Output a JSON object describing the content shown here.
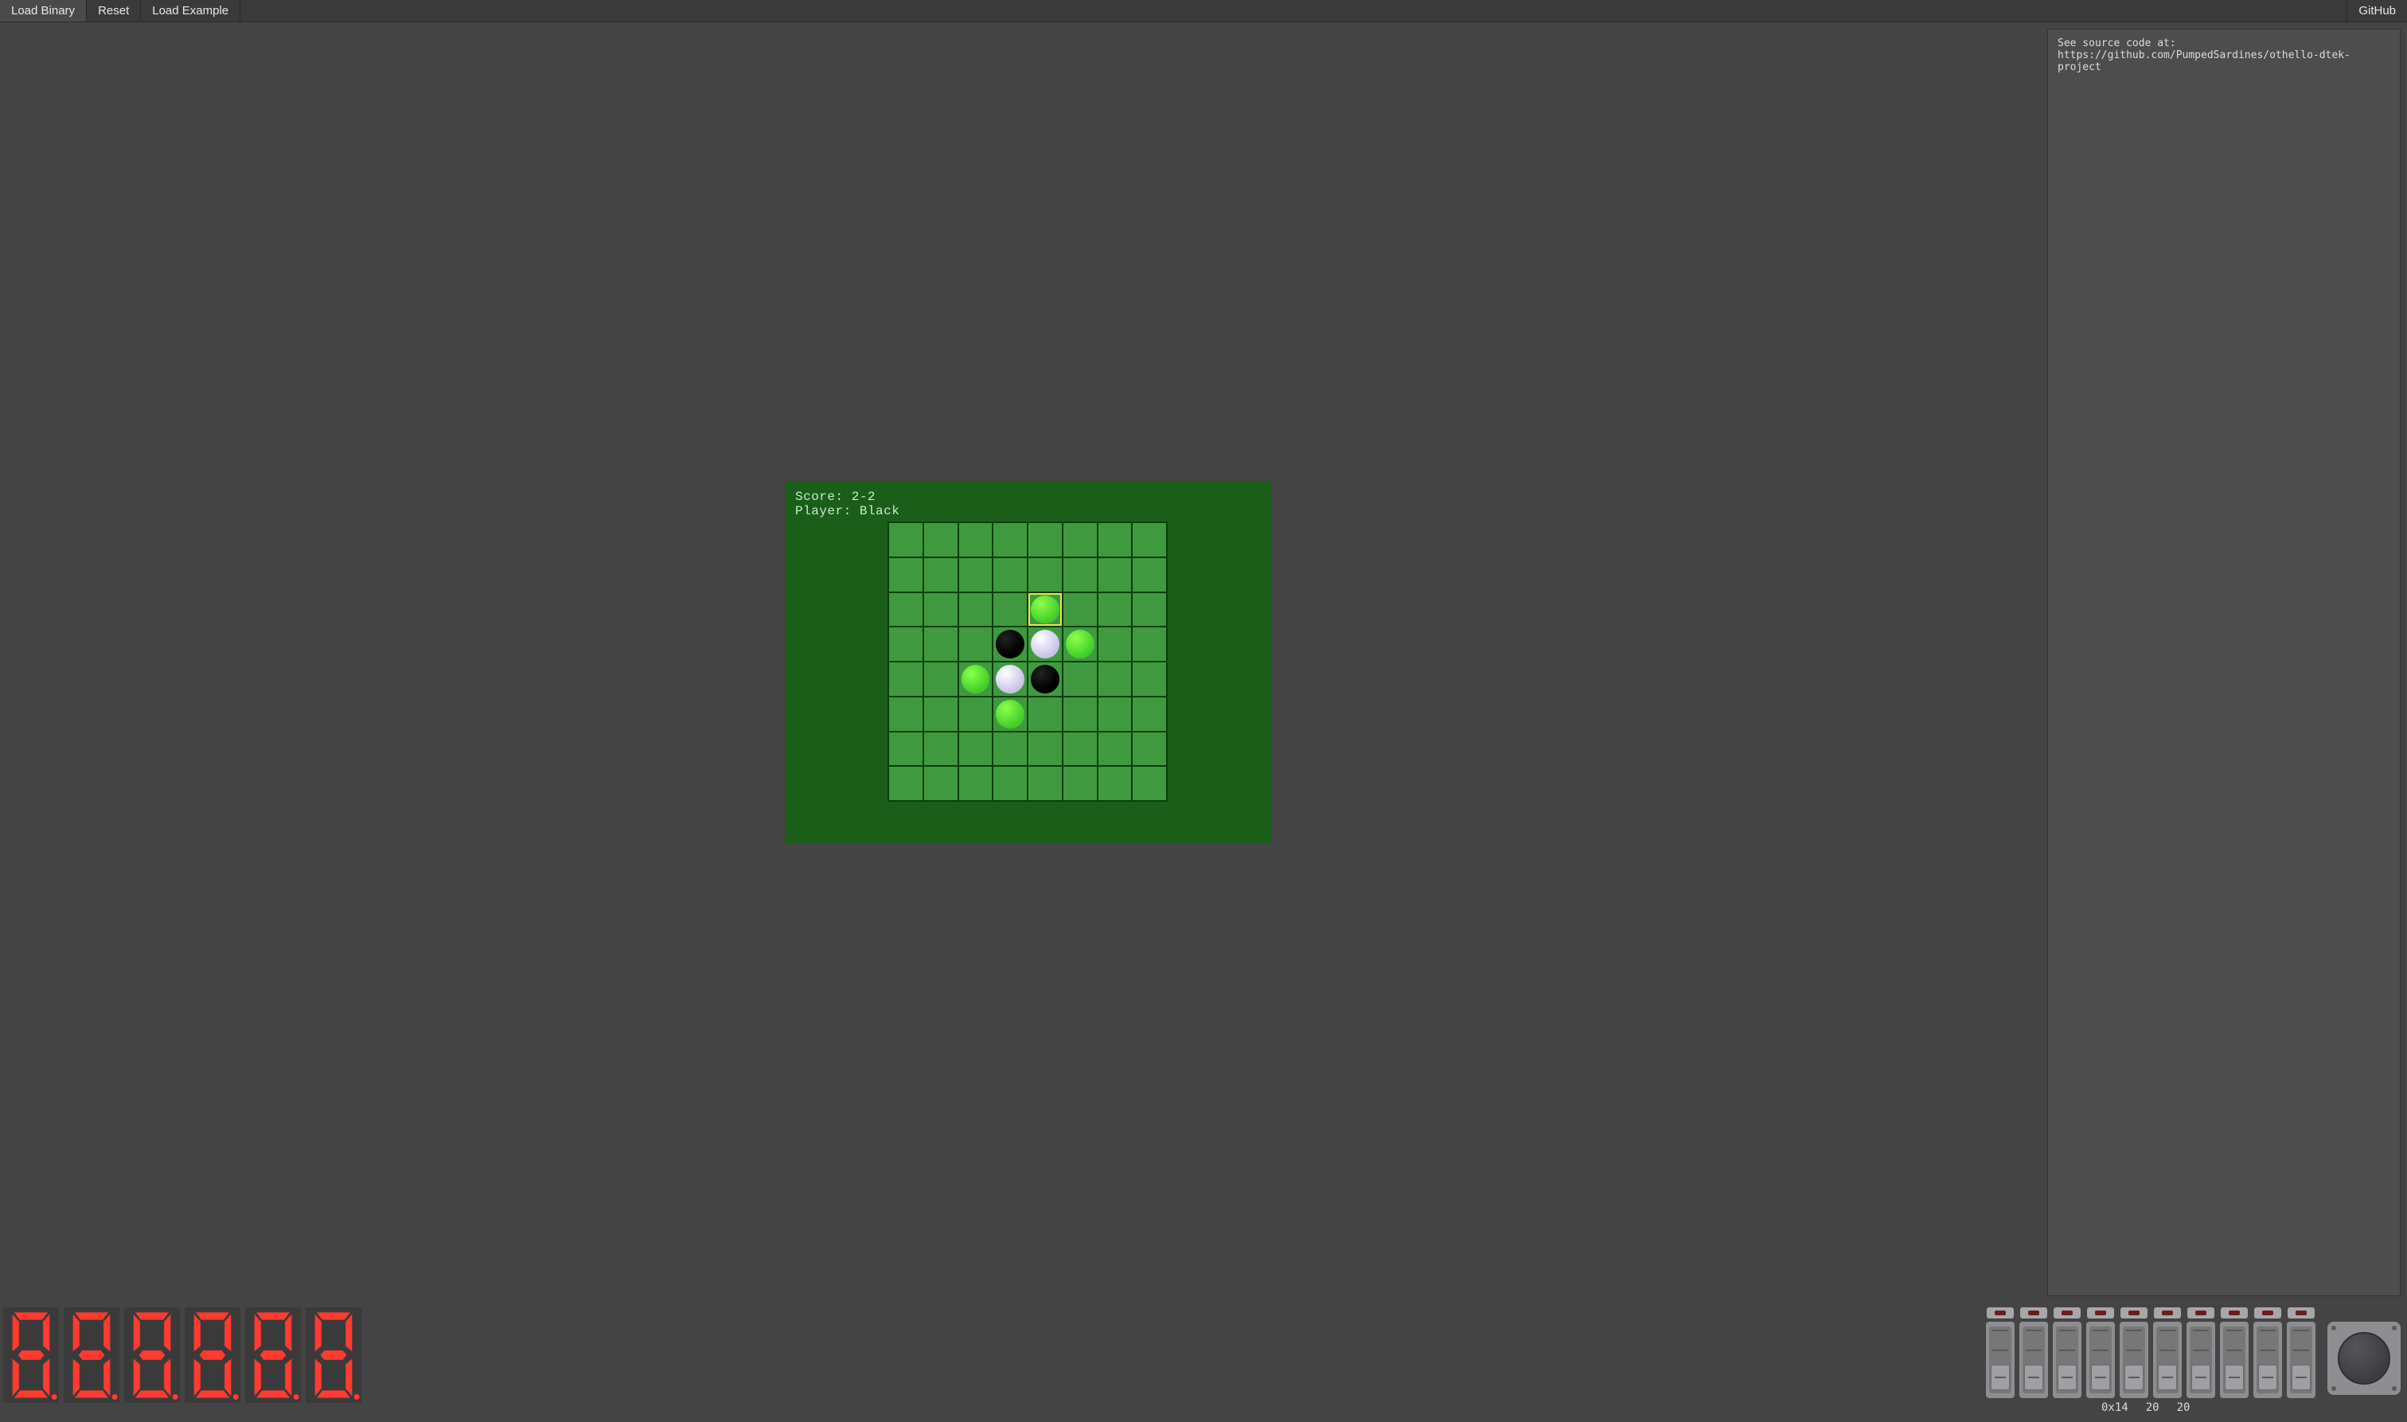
{
  "menubar": {
    "load_binary": "Load Binary",
    "reset": "Reset",
    "load_example": "Load Example",
    "github": "GitHub"
  },
  "console": {
    "text": "See source code at: https://github.com/PumpedSardines/othello-dtek-project"
  },
  "game": {
    "score_line": "Score: 2-2",
    "player_line": "Player: Black",
    "board_size": 8,
    "cursor": {
      "row": 2,
      "col": 4
    },
    "pieces": [
      {
        "row": 2,
        "col": 4,
        "kind": "hint"
      },
      {
        "row": 3,
        "col": 3,
        "kind": "black"
      },
      {
        "row": 3,
        "col": 4,
        "kind": "white"
      },
      {
        "row": 3,
        "col": 5,
        "kind": "hint"
      },
      {
        "row": 4,
        "col": 2,
        "kind": "hint"
      },
      {
        "row": 4,
        "col": 3,
        "kind": "white"
      },
      {
        "row": 4,
        "col": 4,
        "kind": "black"
      },
      {
        "row": 5,
        "col": 3,
        "kind": "hint"
      }
    ]
  },
  "segments": {
    "digits": [
      "8",
      "8",
      "8",
      "8",
      "8",
      "8"
    ]
  },
  "io": {
    "led_states": [
      false,
      false,
      false,
      false,
      false,
      false,
      false,
      false,
      false,
      false
    ],
    "switch_states": [
      0,
      0,
      0,
      0,
      0,
      0,
      0,
      0,
      0,
      0
    ]
  },
  "readout": {
    "hex": "0x14",
    "dec1": "20",
    "dec2": "20"
  }
}
